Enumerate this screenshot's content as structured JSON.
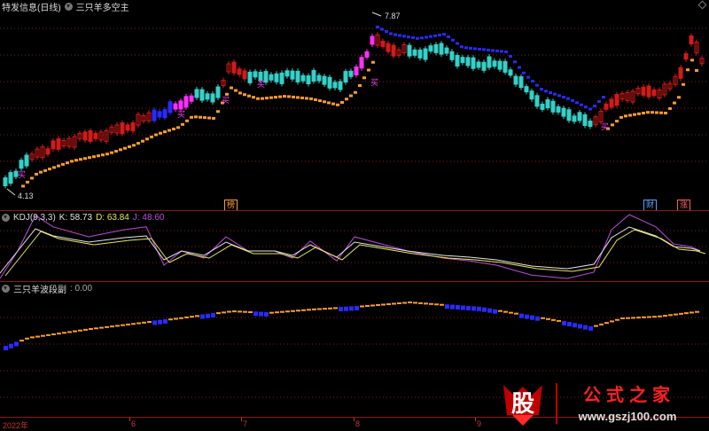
{
  "main_panel": {
    "title": "特发信息(日线)",
    "indicator": "三只羊多空主",
    "high_label": "7.87",
    "low_label": "4.13",
    "buy_marker": "买",
    "events": [
      {
        "text": "榜",
        "color": "#ff9c2a"
      },
      {
        "text": "财",
        "color": "#5aa0ff"
      },
      {
        "text": "涨",
        "color": "#ff6060"
      }
    ]
  },
  "kdj_panel": {
    "title": "KDJ(9,3,3)",
    "k_label": "K: 58.73",
    "d_label": "D: 63.84",
    "j_label": "J: 48.60",
    "colors": {
      "k": "#e6e6e6",
      "d": "#e8e85a",
      "j": "#c04ce0"
    }
  },
  "wave_panel": {
    "title": "三只羊波段副",
    "value": ": 0.00"
  },
  "xaxis": {
    "labels": [
      "2022年",
      "6",
      "7",
      "8",
      "9"
    ]
  },
  "watermark": {
    "logo": "股",
    "title": "公式之家",
    "url": "www.gszj100.com"
  },
  "colors": {
    "up": "#d21a1a",
    "down": "#35d0c8",
    "magenta": "#ff30ff",
    "orange": "#ff9c2a",
    "blue": "#2a2aff",
    "grid": "#8b1a1a"
  }
}
